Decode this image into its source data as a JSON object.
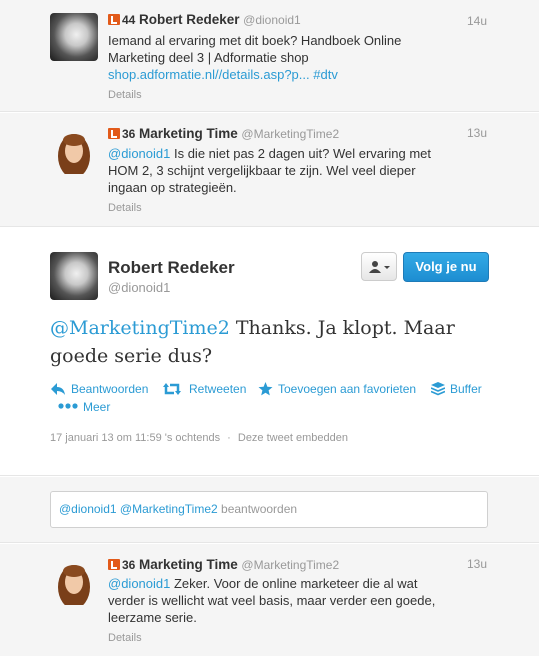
{
  "tweet1": {
    "klout_score": "44",
    "name": "Robert Redeker",
    "handle": "@dionoid1",
    "time": "14u",
    "text_line1": "Iemand al ervaring met dit boek? Handboek Online",
    "text_line2": "Marketing deel 3 | Adformatie shop",
    "link": "shop.adformatie.nl//details.asp?p...",
    "hashtag": "#dtv",
    "details": "Details"
  },
  "tweet2": {
    "klout_score": "36",
    "name": "Marketing Time",
    "handle": "@MarketingTime2",
    "time": "13u",
    "mention": "@dionoid1",
    "text_line1_rest": " Is die niet pas 2 dagen uit? Wel ervaring met",
    "text_line2": "HOM 2, 3 schijnt vergelijkbaar te zijn. Wel veel dieper",
    "text_line3": "ingaan op strategieën.",
    "details": "Details"
  },
  "expanded": {
    "name": "Robert Redeker",
    "handle": "@dionoid1",
    "follow_label": "Volg je nu",
    "mention": "@MarketingTime2",
    "text_line1_rest": " Thanks. Ja klopt. Maar",
    "text_line2": "goede serie dus?",
    "actions": {
      "reply": "Beantwoorden",
      "retweet": "Retweeten",
      "favorite": "Toevoegen aan favorieten",
      "buffer": "Buffer",
      "more": "Meer"
    },
    "timestamp": "17 januari 13 om 11:59 's ochtends",
    "separator": "·",
    "embed": "Deze tweet embedden"
  },
  "reply": {
    "mention1": "@dionoid1",
    "mention2": "@MarketingTime2",
    "placeholder": "beantwoorden"
  },
  "tweet4": {
    "klout_score": "36",
    "name": "Marketing Time",
    "handle": "@MarketingTime2",
    "time": "13u",
    "mention": "@dionoid1",
    "text_line1_rest": " Zeker. Voor de online marketeer die al wat",
    "text_line2": "verder is wellicht wat veel basis, maar verder een goede,",
    "text_line3": "leerzame serie.",
    "details": "Details"
  },
  "colors": {
    "link": "#2b9bd4",
    "follow_button": "#1d8dd1",
    "klout_badge": "#e25a1a",
    "stream_bg": "#f5f5f5"
  },
  "icons": {
    "reply": "reply-arrow-icon",
    "retweet": "retweet-icon",
    "favorite": "star-icon",
    "buffer": "buffer-stack-icon",
    "more": "three-dots-icon",
    "user_dropdown": "user-dropdown-icon"
  }
}
